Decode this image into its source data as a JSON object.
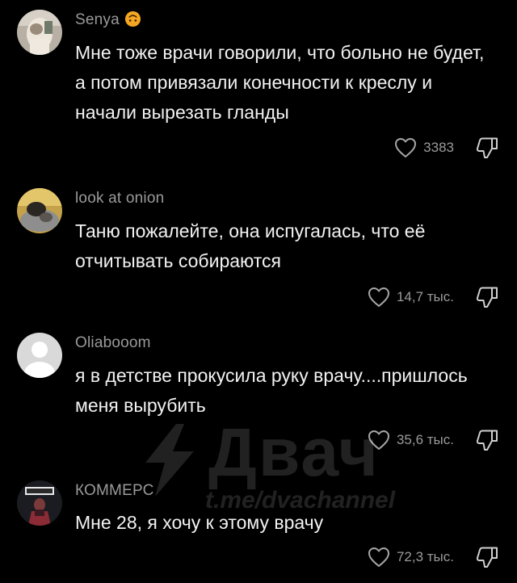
{
  "comments": [
    {
      "username": "Senya",
      "emoji": "upside-down-face-emoji",
      "text": "Мне тоже врачи говорили, что больно не будет, а потом привязали конечности к креслу и начали вырезать гланды",
      "likes": "3383",
      "avatar_icon": "avatar-photo"
    },
    {
      "username": "look at onion",
      "text": "Таню пожалейте, она испугалась, что её отчитывать собираются",
      "likes": "14,7 тыс.",
      "avatar_icon": "avatar-photo"
    },
    {
      "username": "Oliabooom",
      "text": "я в детстве прокусила руку врачу....пришлось меня вырубить",
      "likes": "35,6 тыс.",
      "avatar_icon": "default-avatar"
    },
    {
      "username": "КОММЕРС",
      "text": "Мне 28, я хочу к этому врачу",
      "likes": "72,3 тыс.",
      "avatar_icon": "avatar-photo"
    }
  ],
  "watermark": {
    "title": "Двач",
    "url": "t.me/dvachannel"
  },
  "colors": {
    "background": "#000000",
    "username": "#9a9a9a",
    "text": "#f2f2f2",
    "emoji": "#f5a623"
  }
}
